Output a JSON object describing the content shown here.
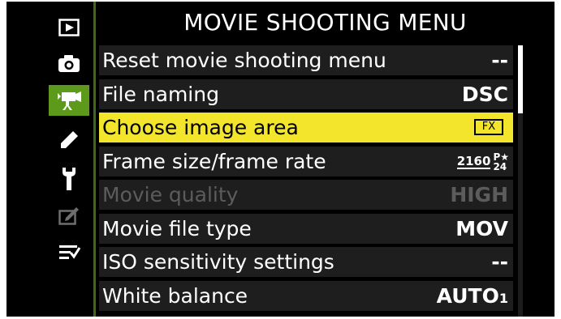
{
  "menu": {
    "title": "MOVIE SHOOTING MENU"
  },
  "sidebar": {
    "items": [
      {
        "icon": "playback-icon",
        "active": false
      },
      {
        "icon": "camera-icon",
        "active": false
      },
      {
        "icon": "movie-camera-icon",
        "active": true
      },
      {
        "icon": "pencil-icon",
        "active": false
      },
      {
        "icon": "wrench-icon",
        "active": false
      },
      {
        "icon": "retouch-icon",
        "active": false
      },
      {
        "icon": "my-menu-icon",
        "active": false
      }
    ]
  },
  "rows": [
    {
      "label": "Reset movie shooting menu",
      "value": "--"
    },
    {
      "label": "File naming",
      "value": "DSC"
    },
    {
      "label": "Choose image area",
      "value": "FX",
      "selected": true
    },
    {
      "label": "Frame size/frame rate",
      "value": "2160",
      "value_sub1": "P★",
      "value_sub2": "24"
    },
    {
      "label": "Movie quality",
      "value": "HIGH",
      "disabled": true
    },
    {
      "label": "Movie file type",
      "value": "MOV"
    },
    {
      "label": "ISO sensitivity settings",
      "value": "--"
    },
    {
      "label": "White balance",
      "value": "AUTO",
      "value_sub": "1"
    }
  ],
  "colors": {
    "highlight": "#f3e52b",
    "active_tab": "#5d9a1c",
    "row_bg": "#1e1e1e",
    "disabled_text": "#5c5c5c"
  }
}
